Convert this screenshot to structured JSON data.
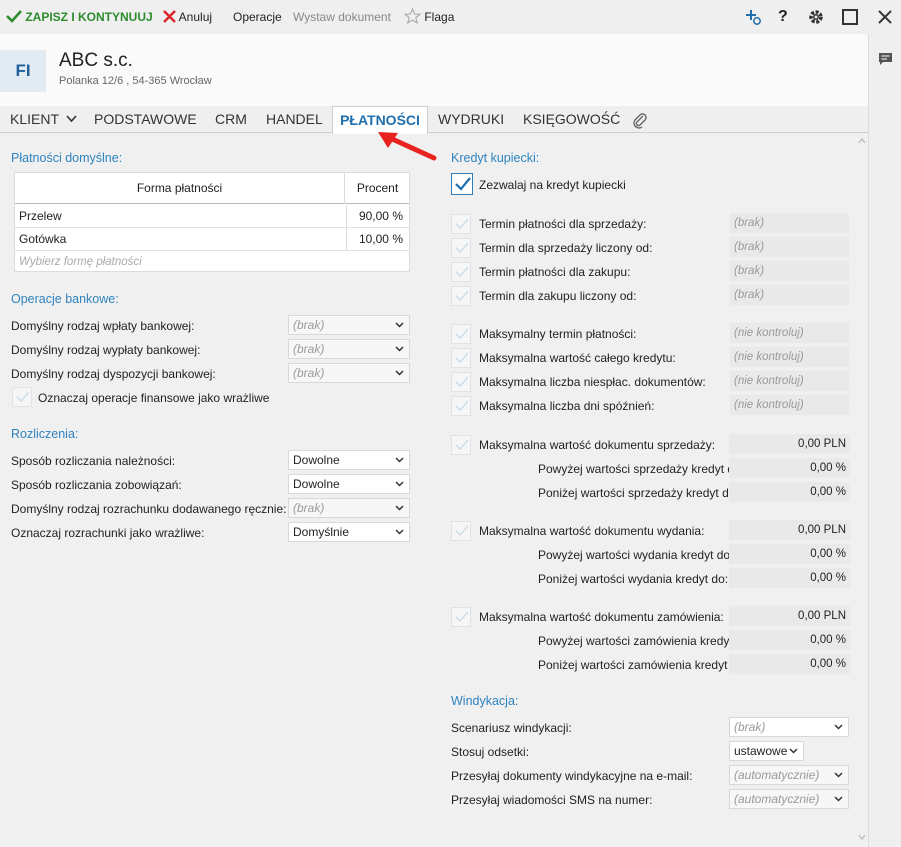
{
  "toolbar": {
    "save_label": "ZAPISZ I KONTYNUUJ",
    "cancel_label": "Anuluj",
    "operations_label": "Operacje",
    "issue_label": "Wystaw dokument",
    "flag_label": "Flaga"
  },
  "header": {
    "initials": "FI",
    "company": "ABC s.c.",
    "address": "Polanka  12/6 , 54-365 Wrocław"
  },
  "tabs": [
    "KLIENT",
    "PODSTAWOWE",
    "CRM",
    "HANDEL",
    "PŁATNOŚCI",
    "WYDRUKI",
    "KSIĘGOWOŚĆ"
  ],
  "payments": {
    "title": "Płatności domyślne:",
    "col_method": "Forma płatności",
    "col_percent": "Procent",
    "rows": [
      {
        "method": "Przelew",
        "percent": "90,00 %"
      },
      {
        "method": "Gotówka",
        "percent": "10,00 %"
      }
    ],
    "placeholder": "Wybierz formę płatności"
  },
  "bank": {
    "title": "Operacje bankowe:",
    "deposit_label": "Domyślny rodzaj wpłaty bankowej:",
    "withdrawal_label": "Domyślny rodzaj wypłaty bankowej:",
    "disposition_label": "Domyślny rodzaj dyspozycji bankowej:",
    "empty_value": "(brak)",
    "sensitive_label": "Oznaczaj operacje finansowe jako wrażliwe"
  },
  "settlements": {
    "title": "Rozliczenia:",
    "receivables_label": "Sposób rozliczania należności:",
    "receivables_value": "Dowolne",
    "liabilities_label": "Sposób rozliczania zobowiązań:",
    "liabilities_value": "Dowolne",
    "manual_label": "Domyślny rodzaj rozrachunku dodawanego ręcznie:",
    "manual_value": "(brak)",
    "sensitive_label": "Oznaczaj rozrachunki jako wrażliwe:",
    "sensitive_value": "Domyślnie"
  },
  "credit": {
    "title": "Kredyt kupiecki:",
    "allow_label": "Zezwalaj na kredyt kupiecki",
    "empty": "(brak)",
    "nocontrol": "(nie kontroluj)",
    "term_sale": "Termin płatności dla sprzedaży:",
    "term_sale_from": "Termin dla sprzedaży liczony od:",
    "term_purchase": "Termin płatności dla zakupu:",
    "term_purchase_from": "Termin dla zakupu liczony od:",
    "max_term": "Maksymalny termin płatności:",
    "max_credit": "Maksymalna wartość całego kredytu:",
    "max_docs": "Maksymalna liczba niespłac. dokumentów:",
    "max_days": "Maksymalna liczba dni spóźnień:",
    "max_sale_doc": "Maksymalna wartość dokumentu sprzedaży:",
    "above_sale": "Powyżej wartości sprzedaży kredyt do:",
    "below_sale": "Poniżej wartości sprzedaży kredyt do:",
    "max_issue_doc": "Maksymalna wartość dokumentu wydania:",
    "above_issue": "Powyżej wartości wydania kredyt do:",
    "below_issue": "Poniżej wartości wydania kredyt do:",
    "max_order_doc": "Maksymalna wartość dokumentu zamówienia:",
    "above_order": "Powyżej wartości zamówienia kredyt do:",
    "below_order": "Poniżej wartości zamówienia kredyt do:",
    "pln_value": "0,00 PLN",
    "pct_value": "0,00 %"
  },
  "collection": {
    "title": "Windykacja:",
    "scenario_label": "Scenariusz windykacji:",
    "scenario_value": "(brak)",
    "interest_label": "Stosuj odsetki:",
    "interest_value": "ustawowe",
    "email_label": "Przesyłaj dokumenty windykacyjne na e-mail:",
    "email_value": "(automatycznie)",
    "sms_label": "Przesyłaj wiadomości SMS na numer:",
    "sms_value": "(automatycznie)"
  },
  "colors": {
    "accent": "#1f6fae",
    "section": "#2e83bf",
    "save": "#2e8b2e",
    "cancel": "#d9262b",
    "arrow": "#e8231f"
  }
}
